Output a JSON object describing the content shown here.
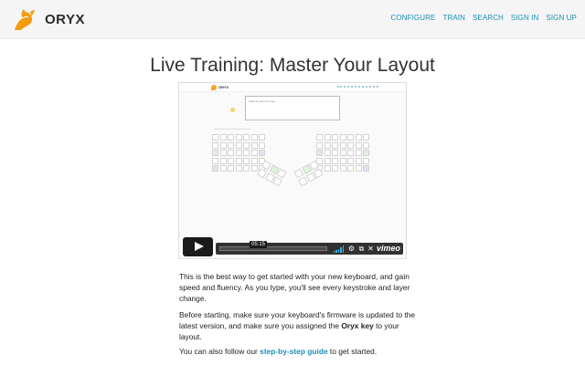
{
  "header": {
    "brand": "ORYX",
    "nav": [
      "CONFIGURE",
      "TRAIN",
      "SEARCH",
      "SIGN IN",
      "SIGN UP"
    ],
    "accent_color": "#1a8fb5",
    "logo_icon": "orange-horse-logo"
  },
  "page": {
    "title": "Live Training: Master Your Layout"
  },
  "video": {
    "time": "05:15",
    "provider": "vimeo",
    "inner_text": "Hello the lazy fox bag",
    "icons": [
      "play-icon",
      "volume-icon",
      "settings-icon",
      "picture-in-picture-icon",
      "fullscreen-icon"
    ]
  },
  "content": {
    "p1": "This is the best way to get started with your new keyboard, and gain speed and fluency. As you type, you'll see every keystroke and layer change.",
    "p2_before": "Before starting, make sure your keyboard's firmware is updated to the latest version, and make sure you assigned the ",
    "p2_bold": "Oryx key",
    "p2_after": " to your layout.",
    "p3_before": "You can also follow our ",
    "p3_link": "step-by-step guide",
    "p3_after": " to get started."
  }
}
